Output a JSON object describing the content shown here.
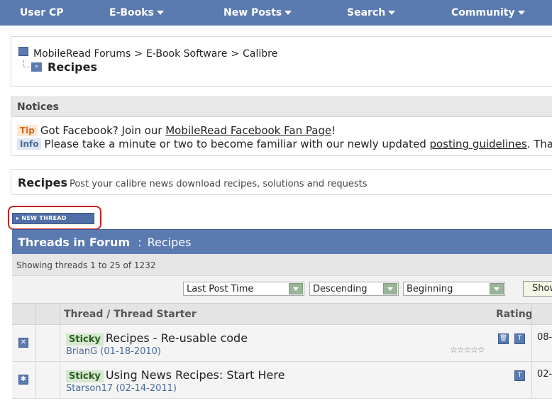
{
  "nav": {
    "items": [
      {
        "label": "User CP",
        "has_menu": false
      },
      {
        "label": "E-Books",
        "has_menu": true
      },
      {
        "label": "New Posts",
        "has_menu": true
      },
      {
        "label": "Search",
        "has_menu": true
      },
      {
        "label": "Community",
        "has_menu": true
      }
    ]
  },
  "breadcrumb": {
    "items": [
      "MobileRead Forums",
      "E-Book Software",
      "Calibre"
    ],
    "separator": ">",
    "current": "Recipes"
  },
  "notices": {
    "heading": "Notices",
    "tip": {
      "tag": "Tip",
      "text_before": "Got Facebook? Join our ",
      "link": "MobileRead Facebook Fan Page",
      "text_after": "!"
    },
    "info": {
      "tag": "Info",
      "text_before": "Please take a minute or two to become familiar with our newly updated ",
      "link": "posting guidelines",
      "text_after": ". Thanks!"
    }
  },
  "forum": {
    "name": "Recipes",
    "description": "Post your calibre news download recipes, solutions and requests"
  },
  "new_thread_label": "NEW THREAD",
  "threads": {
    "title": "Threads in Forum",
    "separator": ":",
    "forum_name": "Recipes",
    "count_text": "Showing threads 1 to 25 of 1232",
    "sort": {
      "sort_by": "Last Post Time",
      "order": "Descending",
      "from": "Beginning",
      "show_label": "Show T"
    },
    "columns": {
      "thread": "Thread / Thread Starter",
      "rating": "Rating"
    },
    "rows": [
      {
        "prefix": "Sticky",
        "title": "Recipes - Re-usable code",
        "starter": "BrianG",
        "date": "(01-18-2010)",
        "rating_stars": "☆☆☆☆☆",
        "last_post": "08-"
      },
      {
        "prefix": "Sticky",
        "title": "Using News Recipes: Start Here",
        "starter": "Starson17",
        "date": "(02-14-2011)",
        "last_post": "02-"
      }
    ]
  },
  "colors": {
    "nav_bg": "#5a7ab0",
    "highlight": "#cc1f1f",
    "sticky_bg": "#d4e8cf"
  }
}
